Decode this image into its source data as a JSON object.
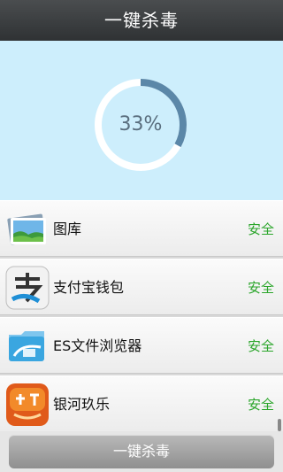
{
  "header": {
    "title": "一键杀毒"
  },
  "scan": {
    "percent_label": "33%",
    "progress": 0.33
  },
  "apps": [
    {
      "name": "图库",
      "status": "安全",
      "icon": "gallery-icon"
    },
    {
      "name": "支付宝钱包",
      "status": "安全",
      "icon": "alipay-icon"
    },
    {
      "name": "ES文件浏览器",
      "status": "安全",
      "icon": "es-file-explorer-icon"
    },
    {
      "name": "银河玖乐",
      "status": "安全",
      "icon": "yinhe-jiule-icon"
    }
  ],
  "footer": {
    "button_label": "一键杀毒"
  },
  "colors": {
    "safe": "#2aa52a",
    "scan_bg": "#cdeefc",
    "progress": "#5b87a8"
  }
}
